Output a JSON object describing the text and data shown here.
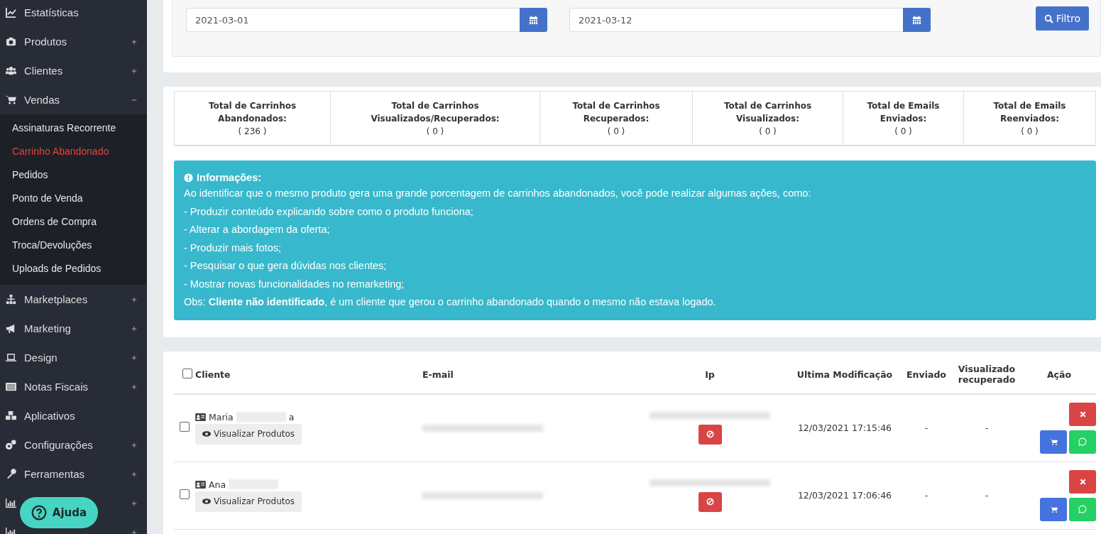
{
  "sidebar": {
    "items": [
      {
        "label": "Estatísticas"
      },
      {
        "label": "Produtos",
        "expanded": false
      },
      {
        "label": "Clientes",
        "expanded": false
      },
      {
        "label": "Vendas",
        "expanded": true,
        "children": [
          {
            "label": "Assinaturas Recorrente",
            "selected": false
          },
          {
            "label": "Carrinho Abandonado",
            "selected": true
          },
          {
            "label": "Pedidos",
            "selected": false
          },
          {
            "label": "Ponto de Venda",
            "selected": false
          },
          {
            "label": "Ordens de Compra",
            "selected": false
          },
          {
            "label": "Troca/Devoluções",
            "selected": false
          },
          {
            "label": "Uploads de Pedidos",
            "selected": false
          }
        ]
      },
      {
        "label": "Marketplaces",
        "expanded": false
      },
      {
        "label": "Marketing",
        "expanded": false
      },
      {
        "label": "Design",
        "expanded": false
      },
      {
        "label": "Notas Fiscais",
        "expanded": false
      },
      {
        "label": "Aplicativos"
      },
      {
        "label": "Configurações",
        "expanded": false
      },
      {
        "label": "Ferramentas",
        "expanded": false
      },
      {
        "expanded": false
      },
      {
        "expanded": false
      }
    ]
  },
  "help_button": {
    "label": "Ajuda"
  },
  "filter": {
    "start_date": {
      "value": "2021-03-01"
    },
    "end_date": {
      "value": "2021-03-12"
    },
    "button": "Filtro"
  },
  "stats": [
    {
      "label": "Total de Carrinhos Abandonados:",
      "value": "( 236 )"
    },
    {
      "label": "Total de Carrinhos Visualizados/Recuperados:",
      "value": "( 0 )"
    },
    {
      "label": "Total de Carrinhos Recuperados:",
      "value": "( 0 )"
    },
    {
      "label": "Total de Carrinhos Visualizados:",
      "value": "( 0 )"
    },
    {
      "label": "Total de Emails Enviados:",
      "value": "( 0 )"
    },
    {
      "label": "Total de Emails Reenviados:",
      "value": "( 0 )"
    }
  ],
  "info": {
    "title": "Informações:",
    "lines": [
      "Ao identificar que o mesmo produto gera uma grande porcentagem de carrinhos abandonados, você pode realizar algumas ações, como:",
      "- Produzir conteúdo explicando sobre como o produto funciona;",
      "- Alterar a abordagem da oferta;",
      "- Produzir mais fotos;",
      "- Pesquisar o que gera dúvidas nos clientes;",
      "- Mostrar novas funcionalidades no remarketing;",
      "Obs: **Cliente não identificado**, é um cliente que gerou o carrinho abandonado quando o mesmo não estava logado."
    ]
  },
  "table": {
    "select_all_checked": false,
    "columns": [
      "Cliente",
      "E-mail",
      "Ip",
      "Ultima Modificação",
      "Enviado",
      "Visualizado recuperado",
      "Ação"
    ],
    "rows": [
      {
        "checked": false,
        "name": "Maria",
        "name_tail": "a",
        "view_button": "Visualizar Produtos",
        "modified": "12/03/2021 17:15:46",
        "sent": "-",
        "recovered": "-"
      },
      {
        "checked": false,
        "name": "Ana",
        "view_button": "Visualizar Produtos",
        "modified": "12/03/2021 17:06:46",
        "sent": "-",
        "recovered": "-"
      }
    ]
  }
}
